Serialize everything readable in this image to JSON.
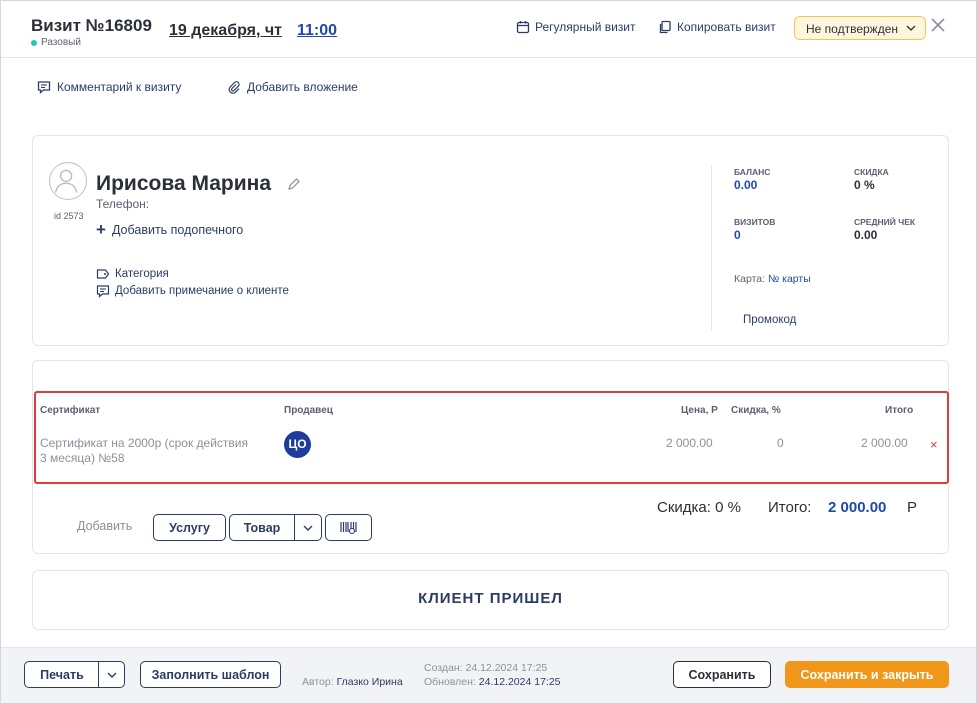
{
  "header": {
    "visit_title": "Визит №16809",
    "visit_type": "Разовый",
    "date": "19 декабря, чт",
    "time": "11:00",
    "regular_visit": "Регулярный визит",
    "copy_visit": "Копировать визит",
    "status": "Не подтвержден",
    "colors": {
      "status_bg": "#fff7dd",
      "status_border": "#f0c45a",
      "type_dot": "#20c8b0"
    }
  },
  "toolbar": {
    "comment": "Комментарий к визиту",
    "attachment": "Добавить вложение"
  },
  "client": {
    "id_label": "id 2573",
    "name": "Ирисова Марина",
    "phone_label": "Телефон:",
    "add_ward": "Добавить подопечного",
    "category": "Категория",
    "add_note": "Добавить примечание о клиенте"
  },
  "stats": {
    "balance_label": "БАЛАНС",
    "balance_value": "0.00",
    "discount_label": "СКИДКА",
    "discount_value": "0 %",
    "visits_label": "ВИЗИТОВ",
    "visits_value": "0",
    "avg_check_label": "СРЕДНИЙ ЧЕК",
    "avg_check_value": "0.00",
    "card_label": "Карта:",
    "card_value": "№ карты",
    "promo": "Промокод"
  },
  "items": {
    "headers": {
      "certificate": "Сертификат",
      "seller": "Продавец",
      "price": "Цена, Р",
      "discount": "Скидка, %",
      "total": "Итого"
    },
    "rows": [
      {
        "name_line1": "Сертификат на 2000р (срок действия",
        "name_line2": "3 месяца) №58",
        "seller_initials": "ЦО",
        "price": "2 000.00",
        "discount": "0",
        "total": "2 000.00",
        "remove": "×"
      }
    ],
    "summary": {
      "discount_text": "Скидка: 0 %",
      "total_label": "Итого:",
      "total_value": "2 000.00",
      "currency": "Р"
    },
    "add_label": "Добавить",
    "add_service": "Услугу",
    "add_product": "Товар"
  },
  "arrived": {
    "label": "КЛИЕНТ ПРИШЕЛ"
  },
  "footer": {
    "print": "Печать",
    "fill_template": "Заполнить шаблон",
    "author_label": "Автор:",
    "author_value": "Глазко Ирина",
    "created_label": "Создан:",
    "created_value": "24.12.2024 17:25",
    "updated_label": "Обновлен:",
    "updated_value": "24.12.2024 17:25",
    "save": "Сохранить",
    "save_close": "Сохранить и закрыть"
  }
}
